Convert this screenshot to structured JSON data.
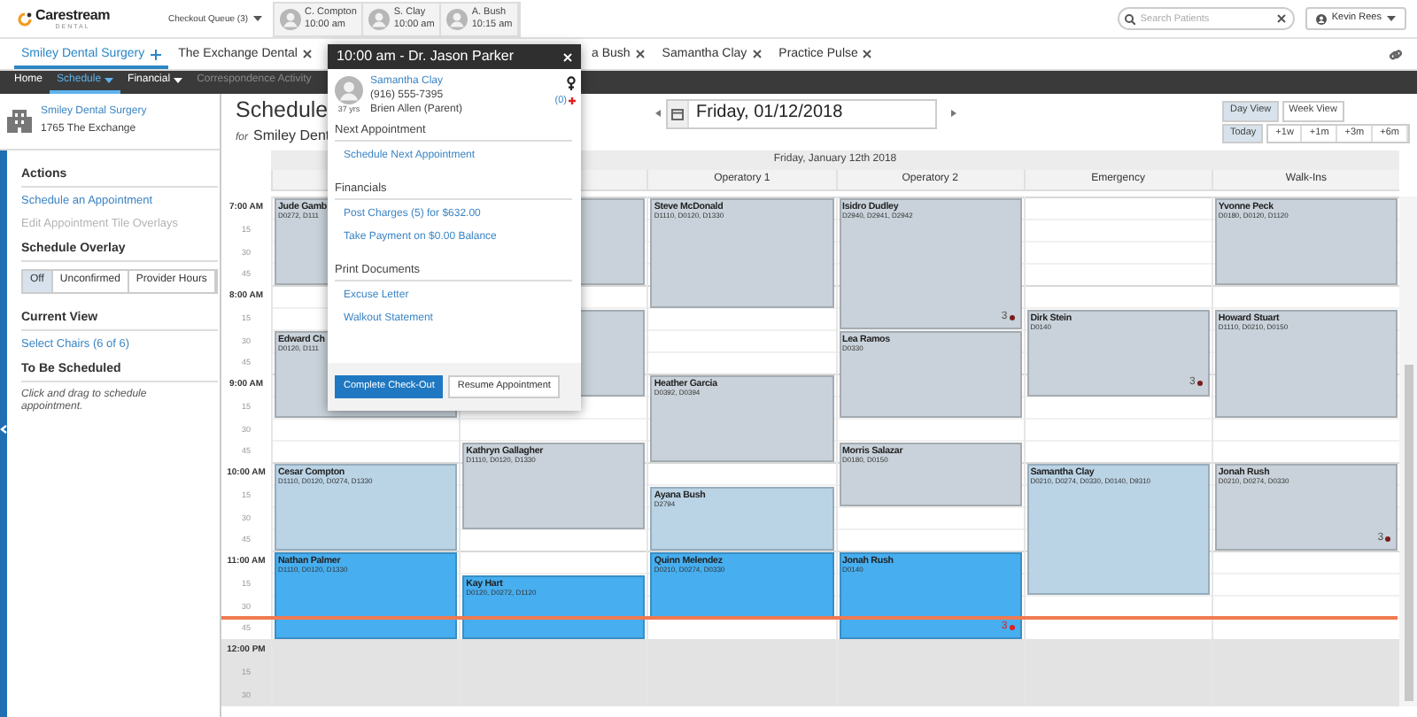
{
  "top_bar": {
    "logo": {
      "name": "Carestream",
      "tagline": "DENTAL"
    },
    "checkout_queue": "Checkout Queue (3)",
    "queue_patients": [
      {
        "name": "C. Compton",
        "time": "10:00 am"
      },
      {
        "name": "S. Clay",
        "time": "10:00 am"
      },
      {
        "name": "A. Bush",
        "time": "10:15 am"
      }
    ],
    "search": {
      "placeholder": "Search Patients"
    },
    "user": "Kevin Rees"
  },
  "tabs": [
    {
      "label": "Smiley Dental Surgery",
      "selected": true,
      "kind": "add"
    },
    {
      "label": "The Exchange Dental",
      "selected": false,
      "kind": "close"
    },
    {
      "label": "a Bush",
      "selected": false,
      "kind": "close"
    },
    {
      "label": "Samantha Clay",
      "selected": false,
      "kind": "close"
    },
    {
      "label": "Practice Pulse",
      "selected": false,
      "kind": "close"
    }
  ],
  "nav": [
    {
      "label": "Home",
      "selected": false,
      "dropdown": false,
      "disabled": false
    },
    {
      "label": "Schedule",
      "selected": true,
      "dropdown": true,
      "disabled": false
    },
    {
      "label": "Financial",
      "selected": false,
      "dropdown": true,
      "disabled": false
    },
    {
      "label": "Correspondence Activity",
      "selected": false,
      "dropdown": false,
      "disabled": true
    }
  ],
  "office": {
    "name": "Smiley Dental Surgery",
    "address": "1765 The Exchange"
  },
  "sidebar": [
    {
      "kind": "links",
      "title": "Actions",
      "links": [
        {
          "label": "Schedule an Appointment",
          "disabled": false
        },
        {
          "label": "Edit Appointment Tile Overlays",
          "disabled": true
        }
      ]
    },
    {
      "kind": "toggle",
      "title": "Schedule Overlay",
      "options": [
        {
          "label": "Off",
          "selected": true
        },
        {
          "label": "Unconfirmed",
          "selected": false
        },
        {
          "label": "Provider Hours",
          "selected": false
        }
      ]
    },
    {
      "kind": "links",
      "title": "Current View",
      "links": [
        {
          "label": "Select Chairs (6 of 6)",
          "disabled": false
        }
      ]
    },
    {
      "kind": "note",
      "title": "To Be Scheduled",
      "note": "Click and drag to schedule appointment."
    }
  ],
  "schedule": {
    "title": "Schedule",
    "subtitle_prefix": "for",
    "subtitle": "Smiley Dent",
    "date": "Friday, 01/12/2018",
    "views": [
      {
        "label": "Day View",
        "selected": true
      },
      {
        "label": "Week View",
        "selected": false
      }
    ],
    "today": "Today",
    "jumps": [
      "+1w",
      "+1m",
      "+3m",
      "+6m"
    ]
  },
  "calendar": {
    "date_heading": "Friday, January 12th 2018",
    "time_slots": [
      {
        "label": "7:00 AM",
        "kind": "hour",
        "closed": false,
        "current": false
      },
      {
        "label": "15",
        "kind": "quarter",
        "closed": false,
        "current": false
      },
      {
        "label": "30",
        "kind": "quarter",
        "closed": false,
        "current": false
      },
      {
        "label": "45",
        "kind": "quarter",
        "closed": false,
        "current": false
      },
      {
        "label": "8:00 AM",
        "kind": "hour",
        "closed": false,
        "current": false
      },
      {
        "label": "15",
        "kind": "quarter",
        "closed": false,
        "current": false
      },
      {
        "label": "30",
        "kind": "quarter",
        "closed": false,
        "current": false
      },
      {
        "label": "45",
        "kind": "quarter",
        "closed": false,
        "current": false
      },
      {
        "label": "9:00 AM",
        "kind": "hour",
        "closed": false,
        "current": false
      },
      {
        "label": "15",
        "kind": "quarter",
        "closed": false,
        "current": false
      },
      {
        "label": "30",
        "kind": "quarter",
        "closed": false,
        "current": false
      },
      {
        "label": "45",
        "kind": "quarter",
        "closed": false,
        "current": false
      },
      {
        "label": "10:00 AM",
        "kind": "hour",
        "closed": false,
        "current": false
      },
      {
        "label": "15",
        "kind": "quarter",
        "closed": false,
        "current": false
      },
      {
        "label": "30",
        "kind": "quarter",
        "closed": false,
        "current": false
      },
      {
        "label": "45",
        "kind": "quarter",
        "closed": false,
        "current": false
      },
      {
        "label": "11:00 AM",
        "kind": "hour",
        "closed": false,
        "current": false
      },
      {
        "label": "15",
        "kind": "quarter",
        "closed": false,
        "current": false
      },
      {
        "label": "30",
        "kind": "quarter",
        "closed": false,
        "current": false
      },
      {
        "label": "45",
        "kind": "quarter",
        "closed": false,
        "current": true
      },
      {
        "label": "12:00 PM",
        "kind": "hour",
        "closed": true,
        "current": false
      },
      {
        "label": "15",
        "kind": "quarter",
        "closed": true,
        "current": false
      },
      {
        "label": "30",
        "kind": "quarter",
        "closed": true,
        "current": false
      }
    ],
    "columns": [
      {
        "slots": [
          {
            "kind": "appointment",
            "name": "Jude Gamb",
            "codes": "D0272, D111",
            "color": "#c9d2da"
          },
          {
            "kind": "continued"
          },
          {
            "kind": "continued"
          },
          {
            "kind": "continued"
          },
          {
            "kind": "free"
          },
          {
            "kind": "free"
          },
          {
            "kind": "appointment",
            "name": "Edward Ch",
            "codes": "D0120, D111",
            "color": "#c9d2da"
          },
          {
            "kind": "continued"
          },
          {
            "kind": "continued"
          },
          {
            "kind": "continued"
          },
          {
            "kind": "free"
          },
          {
            "kind": "free"
          },
          {
            "kind": "appointment",
            "name": "Cesar Compton",
            "codes": "D1110, D0120, D0274, D1330",
            "color": "#bad3e5"
          },
          {
            "kind": "continued"
          },
          {
            "kind": "continued"
          },
          {
            "kind": "continued"
          },
          {
            "kind": "appointment",
            "name": "Nathan Palmer",
            "codes": "D1110, D0120, D1330",
            "color": "#47aeef"
          },
          {
            "kind": "continued"
          },
          {
            "kind": "continued"
          },
          {
            "kind": "continued"
          },
          {
            "kind": "free"
          },
          {
            "kind": "free"
          },
          {
            "kind": "free"
          }
        ]
      },
      {
        "slots": [
          {
            "kind": "appointment",
            "color": "#c9d2da"
          },
          {
            "kind": "continued"
          },
          {
            "kind": "continued"
          },
          {
            "kind": "continued"
          },
          {
            "kind": "free"
          },
          {
            "kind": "appointment",
            "color": "#c9d2da"
          },
          {
            "kind": "continued"
          },
          {
            "kind": "continued"
          },
          {
            "kind": "continued"
          },
          {
            "kind": "free"
          },
          {
            "kind": "free"
          },
          {
            "kind": "appointment",
            "name": "Kathryn Gallagher",
            "codes": "D1110, D0120, D1330",
            "color": "#c9d2da"
          },
          {
            "kind": "continued"
          },
          {
            "kind": "continued"
          },
          {
            "kind": "continued"
          },
          {
            "kind": "free"
          },
          {
            "kind": "free"
          },
          {
            "kind": "appointment",
            "name": "Kay Hart",
            "codes": "D0120, D0272, D1120",
            "color": "#47aeef"
          },
          {
            "kind": "continued"
          },
          {
            "kind": "continued"
          },
          {
            "kind": "free"
          },
          {
            "kind": "free"
          },
          {
            "kind": "free"
          }
        ]
      },
      {
        "label": "Operatory 1",
        "slots": [
          {
            "kind": "appointment",
            "name": "Steve McDonald",
            "codes": "D1110, D0120, D1330",
            "color": "#c9d2da"
          },
          {
            "kind": "continued"
          },
          {
            "kind": "continued"
          },
          {
            "kind": "continued"
          },
          {
            "kind": "continued"
          },
          {
            "kind": "free"
          },
          {
            "kind": "free"
          },
          {
            "kind": "free"
          },
          {
            "kind": "appointment",
            "name": "Heather Garcia",
            "codes": "D0392, D0394",
            "color": "#c9d2da"
          },
          {
            "kind": "continued"
          },
          {
            "kind": "continued"
          },
          {
            "kind": "continued"
          },
          {
            "kind": "free"
          },
          {
            "kind": "appointment",
            "name": "Ayana Bush",
            "codes": "D2794",
            "color": "#bad3e5"
          },
          {
            "kind": "continued"
          },
          {
            "kind": "continued"
          },
          {
            "kind": "appointment",
            "name": "Quinn Melendez",
            "codes": "D0210, D0274, D0330",
            "color": "#47aeef"
          },
          {
            "kind": "continued"
          },
          {
            "kind": "continued"
          },
          {
            "kind": "free"
          },
          {
            "kind": "free"
          },
          {
            "kind": "free"
          },
          {
            "kind": "free"
          }
        ]
      },
      {
        "label": "Operatory 2",
        "slots": [
          {
            "kind": "appointment",
            "name": "Isidro Dudley",
            "codes": "D2940, D2941, D2942",
            "color": "#c9d2da",
            "alert": {
              "count": "3",
              "urgent": false
            }
          },
          {
            "kind": "continued"
          },
          {
            "kind": "continued"
          },
          {
            "kind": "continued"
          },
          {
            "kind": "continued"
          },
          {
            "kind": "continued"
          },
          {
            "kind": "appointment",
            "name": "Lea Ramos",
            "codes": "D0330",
            "color": "#c9d2da"
          },
          {
            "kind": "continued"
          },
          {
            "kind": "continued"
          },
          {
            "kind": "continued"
          },
          {
            "kind": "free"
          },
          {
            "kind": "appointment",
            "name": "Morris Salazar",
            "codes": "D0180, D0150",
            "color": "#c9d2da"
          },
          {
            "kind": "continued"
          },
          {
            "kind": "continued"
          },
          {
            "kind": "free"
          },
          {
            "kind": "free"
          },
          {
            "kind": "appointment",
            "name": "Jonah Rush",
            "codes": "D0140",
            "color": "#47aeef",
            "alert": {
              "count": "3",
              "urgent": true
            }
          },
          {
            "kind": "continued"
          },
          {
            "kind": "continued"
          },
          {
            "kind": "continued"
          },
          {
            "kind": "free"
          },
          {
            "kind": "free"
          },
          {
            "kind": "free"
          }
        ]
      },
      {
        "label": "Emergency",
        "slots": [
          {
            "kind": "free"
          },
          {
            "kind": "free"
          },
          {
            "kind": "free"
          },
          {
            "kind": "free"
          },
          {
            "kind": "free"
          },
          {
            "kind": "appointment",
            "name": "Dirk Stein",
            "codes": "D0140",
            "color": "#c9d2da",
            "alert": {
              "count": "3",
              "urgent": false
            }
          },
          {
            "kind": "continued"
          },
          {
            "kind": "continued"
          },
          {
            "kind": "continued"
          },
          {
            "kind": "free"
          },
          {
            "kind": "free"
          },
          {
            "kind": "free"
          },
          {
            "kind": "appointment",
            "name": "Samantha Clay",
            "codes": "D0210, D0274, D0330, D0140, D9310",
            "color": "#bad3e5"
          },
          {
            "kind": "continued"
          },
          {
            "kind": "continued"
          },
          {
            "kind": "continued"
          },
          {
            "kind": "continued"
          },
          {
            "kind": "continued"
          },
          {
            "kind": "free"
          },
          {
            "kind": "free"
          },
          {
            "kind": "free"
          },
          {
            "kind": "free"
          },
          {
            "kind": "free"
          }
        ]
      },
      {
        "label": "Walk-Ins",
        "slots": [
          {
            "kind": "appointment",
            "name": "Yvonne Peck",
            "codes": "D0180, D0120, D1120",
            "color": "#c9d2da"
          },
          {
            "kind": "continued"
          },
          {
            "kind": "continued"
          },
          {
            "kind": "continued"
          },
          {
            "kind": "free"
          },
          {
            "kind": "appointment",
            "name": "Howard Stuart",
            "codes": "D1110, D0210, D0150",
            "color": "#c9d2da"
          },
          {
            "kind": "continued"
          },
          {
            "kind": "continued"
          },
          {
            "kind": "continued"
          },
          {
            "kind": "continued"
          },
          {
            "kind": "free"
          },
          {
            "kind": "free"
          },
          {
            "kind": "appointment",
            "name": "Jonah Rush",
            "codes": "D0210, D0274, D0330",
            "color": "#c9d2da",
            "alert": {
              "count": "3",
              "urgent": false
            }
          },
          {
            "kind": "continued"
          },
          {
            "kind": "continued"
          },
          {
            "kind": "continued"
          },
          {
            "kind": "free"
          },
          {
            "kind": "free"
          },
          {
            "kind": "free"
          },
          {
            "kind": "free"
          },
          {
            "kind": "free"
          },
          {
            "kind": "free"
          },
          {
            "kind": "free"
          }
        ]
      }
    ]
  },
  "popup": {
    "title": "10:00 am - Dr. Jason Parker",
    "patient": {
      "name": "Samantha Clay",
      "phone": "(916) 555-7395",
      "guardian": "Brien Allen (Parent)",
      "age": "37 yrs",
      "alerts": "(0)"
    },
    "sections": [
      {
        "title": "Next Appointment",
        "links": [
          "Schedule Next Appointment"
        ]
      },
      {
        "title": "Financials",
        "links": [
          "Post Charges (5) for $632.00",
          "Take Payment on $0.00 Balance"
        ]
      },
      {
        "title": "Print Documents",
        "links": [
          "Excuse Letter",
          "Walkout Statement"
        ]
      }
    ],
    "buttons": [
      {
        "label": "Complete Check-Out",
        "primary": true
      },
      {
        "label": "Resume Appointment",
        "primary": false
      }
    ]
  }
}
